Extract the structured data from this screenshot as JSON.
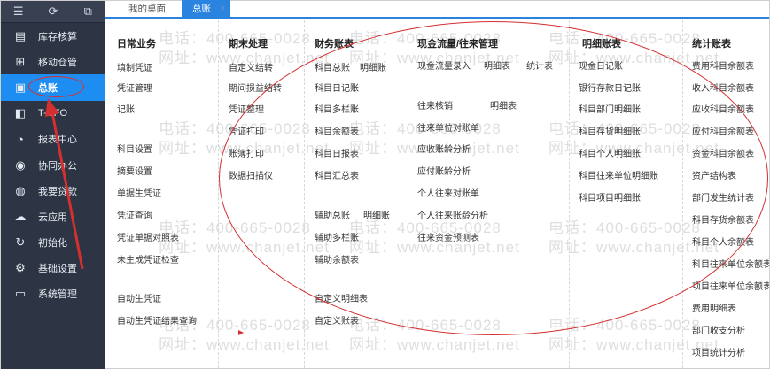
{
  "sidebar": {
    "items": [
      {
        "label": "库存核算",
        "icon": "inventory-icon"
      },
      {
        "label": "移动仓管",
        "icon": "grid-plus-icon"
      },
      {
        "label": "总账",
        "icon": "ledger-icon"
      },
      {
        "label": "T-UFO",
        "icon": "ufo-icon"
      },
      {
        "label": "报表中心",
        "icon": "pie-chart-icon"
      },
      {
        "label": "协同办公",
        "icon": "collab-icon"
      },
      {
        "label": "我要贷款",
        "icon": "loan-icon"
      },
      {
        "label": "云应用",
        "icon": "cloud-icon"
      },
      {
        "label": "初始化",
        "icon": "refresh-icon"
      },
      {
        "label": "基础设置",
        "icon": "gear-icon"
      },
      {
        "label": "系统管理",
        "icon": "monitor-icon"
      }
    ]
  },
  "tabs": [
    {
      "label": "我的桌面"
    },
    {
      "label": "总账",
      "close": "×"
    }
  ],
  "columns": [
    {
      "title": "日常业务",
      "items": [
        "填制凭证",
        "凭证管理",
        "记账",
        "科目设置",
        "摘要设置",
        "单据生凭证",
        "凭证查询",
        "凭证单据对照表",
        "未生成凭证检查",
        "自动生凭证",
        "自动生凭证结果查询"
      ]
    },
    {
      "title": "期末处理",
      "items": [
        "自定义结转",
        "期间损益结转",
        "凭证整理",
        "凭证打印",
        "账簿打印",
        "数据扫描仪"
      ]
    },
    {
      "title": "财务账表",
      "items": [
        "科目总账",
        "明细账",
        "科目日记账",
        "科目多栏账",
        "科目余额表",
        "科目日报表",
        "科目汇总表",
        "辅助总账",
        "明细账",
        "辅助多栏账",
        "辅助余额表",
        "自定义明细表",
        "自定义账表"
      ]
    },
    {
      "title": "现金流量/往来管理",
      "items": [
        "现金流量录入",
        "明细表",
        "统计表",
        "往来核销",
        "明细表",
        "往来单位对账单",
        "应收账龄分析",
        "应付账龄分析",
        "个人往来对账单",
        "个人往来账龄分析",
        "往来资金预测表"
      ]
    },
    {
      "title": "明细账表",
      "items": [
        "现金日记账",
        "银行存款日记账",
        "科目部门明细账",
        "科目存货明细账",
        "科目个人明细账",
        "科目往来单位明细账",
        "科目项目明细账"
      ]
    },
    {
      "title": "统计账表",
      "items": [
        "费用科目余额表",
        "收入科目余额表",
        "应收科目余额表",
        "应付科目余额表",
        "资金科目余额表",
        "资产结构表",
        "部门发生统计表",
        "科目存货余额表",
        "科目个人余额表",
        "科目往来单位余额表",
        "项目往来单位余额表",
        "费用明细表",
        "部门收支分析",
        "项目统计分析"
      ]
    }
  ],
  "watermark": {
    "phone": "电话：400-665-0028",
    "site": "网址：www.chanjet.net"
  }
}
